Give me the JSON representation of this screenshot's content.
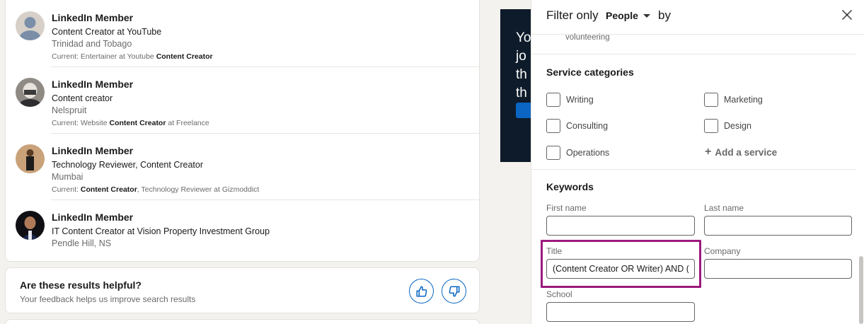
{
  "results": [
    {
      "name": "LinkedIn Member",
      "headline": "Content Creator at YouTube",
      "location": "Trinidad and Tobago",
      "current_prefix": "Current: Entertainer at Youtube ",
      "current_bold": "Content Creator",
      "current_suffix": ""
    },
    {
      "name": "LinkedIn Member",
      "headline": "Content creator",
      "location": "Nelspruit",
      "current_prefix": "Current: Website ",
      "current_bold": "Content Creator",
      "current_suffix": " at Freelance"
    },
    {
      "name": "LinkedIn Member",
      "headline": "Technology Reviewer, Content Creator",
      "location": "Mumbai",
      "current_prefix": "Current: ",
      "current_bold": "Content Creator",
      "current_suffix": ", Technology Reviewer at Gizmoddict"
    },
    {
      "name": "LinkedIn Member",
      "headline": "IT Content Creator at Vision Property Investment Group",
      "location": "Pendle Hill, NS"
    }
  ],
  "feedback": {
    "title": "Are these results helpful?",
    "subtitle": "Your feedback helps us improve search results"
  },
  "ad": {
    "lines": [
      "Yo",
      "jo",
      "th",
      "th"
    ]
  },
  "filter_panel": {
    "filter_label": "Filter only",
    "type_value": "People",
    "by_label": "by",
    "volunteering_text": "volunteering",
    "service_categories": {
      "title": "Service categories",
      "options": [
        "Writing",
        "Marketing",
        "Consulting",
        "Design",
        "Operations"
      ],
      "add_label": "Add a service"
    },
    "keywords": {
      "title": "Keywords",
      "first_name_label": "First name",
      "first_name_value": "",
      "last_name_label": "Last name",
      "last_name_value": "",
      "title_label": "Title",
      "title_value": "(Content Creator OR Writer) AND (",
      "company_label": "Company",
      "company_value": "",
      "school_label": "School",
      "school_value": ""
    }
  },
  "colors": {
    "highlight": "#9b1a7d",
    "brand_blue": "#0a66c2"
  }
}
